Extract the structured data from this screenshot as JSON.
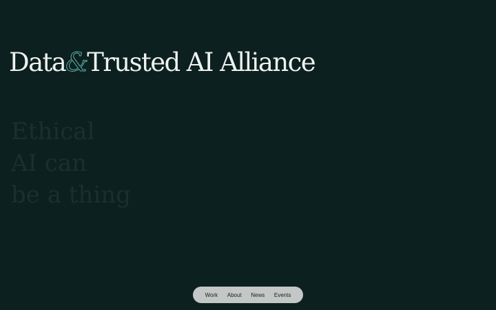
{
  "brand": {
    "part1": "Data",
    "ampersand": "&",
    "part2": "Trusted AI Alliance"
  },
  "hero_faded_lines": [
    "Ethical",
    "AI can",
    "be a thing"
  ],
  "nav": {
    "items": [
      "Work",
      "About",
      "News",
      "Events"
    ]
  },
  "colors": {
    "background": "#0c201f",
    "accent": "#5fb3a9",
    "title": "#eef2ef",
    "nav_pill": "#c3c7c6"
  }
}
